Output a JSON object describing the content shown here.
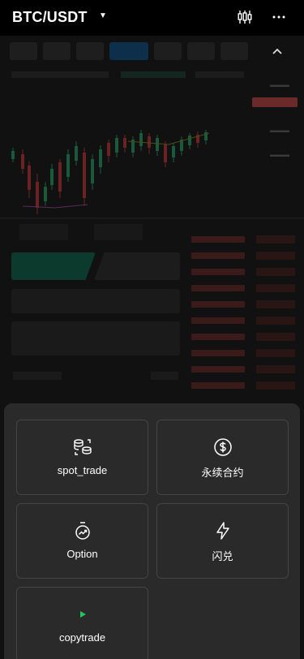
{
  "header": {
    "pair": "BTC/USDT",
    "caret_icon": "caret-down-icon",
    "chart_settings_icon": "candlestick-settings-icon",
    "more_icon": "more-horizontal-icon"
  },
  "menu": {
    "items": [
      {
        "label": "spot_trade",
        "icon": "coins-exchange-icon"
      },
      {
        "label": "永续合约",
        "icon": "dollar-circle-icon"
      },
      {
        "label": "Option",
        "icon": "stopwatch-trend-icon"
      },
      {
        "label": "闪兑",
        "icon": "lightning-icon"
      },
      {
        "label": "copytrade",
        "icon": "play-triangle-icon"
      }
    ]
  },
  "colors": {
    "sheet_bg": "#2a2a2a",
    "card_border": "#444444",
    "up": "#1f9a5a",
    "down": "#c0392b",
    "accent_green": "#22c55e"
  }
}
